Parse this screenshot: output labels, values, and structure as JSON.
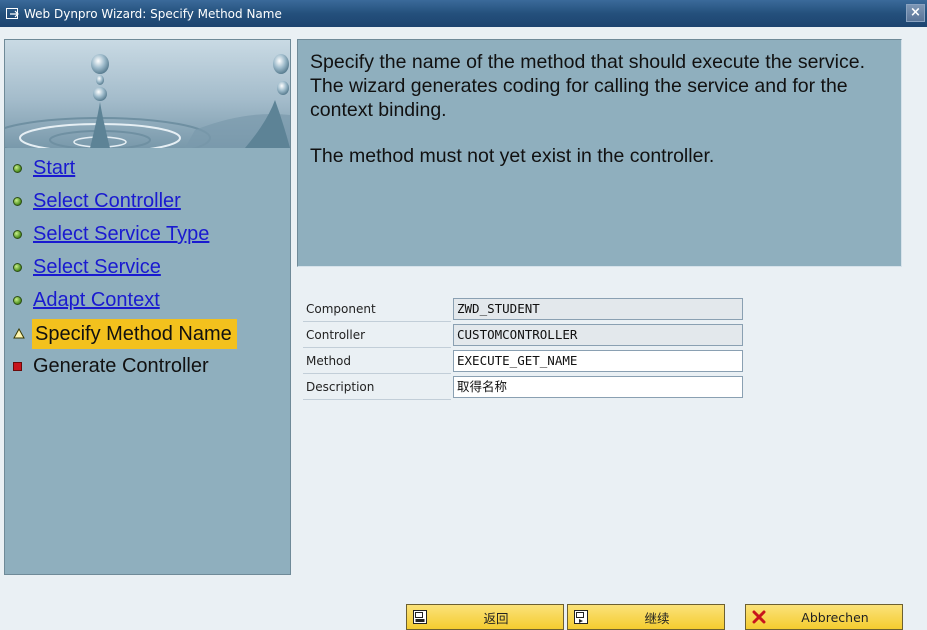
{
  "window": {
    "title": "Web Dynpro Wizard: Specify Method Name",
    "close_glyph": "×"
  },
  "nav": {
    "steps": [
      {
        "label": "Start",
        "status": "done",
        "icon": "green-dot-icon"
      },
      {
        "label": "Select Controller",
        "status": "done",
        "icon": "green-dot-icon"
      },
      {
        "label": "Select Service Type",
        "status": "done",
        "icon": "green-dot-icon"
      },
      {
        "label": "Select Service",
        "status": "done",
        "icon": "green-dot-icon"
      },
      {
        "label": "Adapt Context",
        "status": "done",
        "icon": "green-dot-icon"
      },
      {
        "label": "Specify Method Name",
        "status": "current",
        "icon": "yellow-triangle-icon"
      },
      {
        "label": "Generate Controller",
        "status": "pending",
        "icon": "red-square-icon"
      }
    ]
  },
  "info": {
    "paragraph1": "Specify the name of the method that should execute the service. The wizard generates coding for calling the service and for the context binding.",
    "paragraph2": "The method must not yet exist in the controller."
  },
  "form": {
    "component": {
      "label": "Component",
      "value": "ZWD_STUDENT"
    },
    "controller": {
      "label": "Controller",
      "value": "CUSTOMCONTROLLER"
    },
    "method": {
      "label": "Method",
      "value": "EXECUTE_GET_NAME"
    },
    "description": {
      "label": "Description",
      "value": "取得名称"
    }
  },
  "buttons": {
    "back": {
      "label": "返回",
      "icon": "back-icon"
    },
    "continue": {
      "label": "继续",
      "icon": "continue-icon"
    },
    "cancel": {
      "label": "Abbrechen",
      "icon": "cancel-x-icon"
    }
  },
  "colors": {
    "titlebar": "#24507c",
    "panel": "#8fafbe",
    "button": "#f4cc2f",
    "current_step_highlight": "#f3c11d",
    "link": "#1a1ad0"
  }
}
